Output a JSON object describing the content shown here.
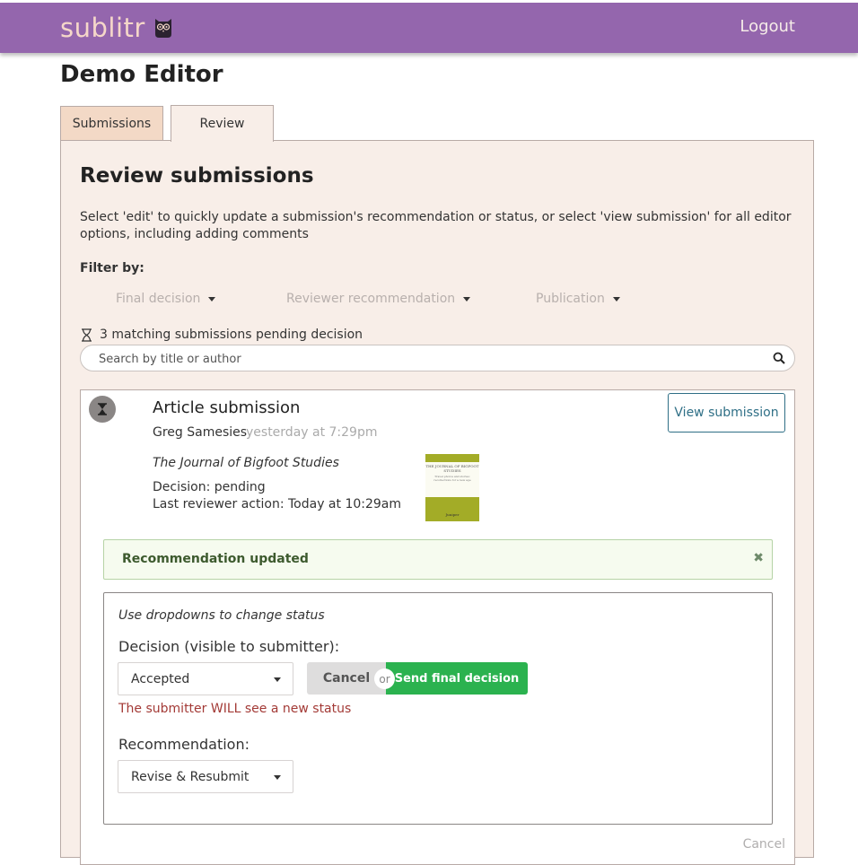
{
  "header": {
    "brand": "sublitr",
    "brand_color": "#9466ad",
    "logo_icon": "owl-icon",
    "logout_label": "Logout"
  },
  "page": {
    "title": "Demo Editor"
  },
  "tabs": [
    {
      "label": "Submissions",
      "active": false
    },
    {
      "label": "Review",
      "active": true
    }
  ],
  "review": {
    "title": "Review submissions",
    "description": "Select 'edit' to quickly update a submission's recommendation or status, or select 'view submission' for all editor options, including adding comments",
    "filter_label": "Filter by:",
    "filters": [
      {
        "label": "Final decision"
      },
      {
        "label": "Reviewer recommendation"
      },
      {
        "label": "Publication"
      }
    ],
    "matching_text": "3 matching submissions pending decision",
    "search": {
      "placeholder": "Search by title or author",
      "value": ""
    }
  },
  "submission": {
    "status_icon": "hourglass-icon",
    "title": "Article submission",
    "author": "Greg Samesies",
    "timestamp": "yesterday at 7:29pm",
    "journal": "The Journal of Bigfoot Studies",
    "decision": "Decision: pending",
    "last_action": "Last reviewer action: Today at 10:29am",
    "view_button": "View submission",
    "cover": {
      "title": "THE JOURNAL OF BIGFOOT STUDIES",
      "subtitle": "Travel photos and stories: recollections for a new age",
      "imprint": "Juniper",
      "color": "#a3ac27"
    },
    "alert": {
      "text": "Recommendation updated",
      "close_icon": "close-icon"
    },
    "edit": {
      "hint": "Use dropdowns to change status",
      "decision_label": "Decision (visible to submitter):",
      "decision_value": "Accepted",
      "cancel_label": "Cancel",
      "or_label": "or",
      "send_label": "Send final decision",
      "warning": "The submitter WILL see a new status",
      "recommendation_label": "Recommendation:",
      "recommendation_value": "Revise & Resubmit"
    },
    "cancel_link": "Cancel"
  }
}
